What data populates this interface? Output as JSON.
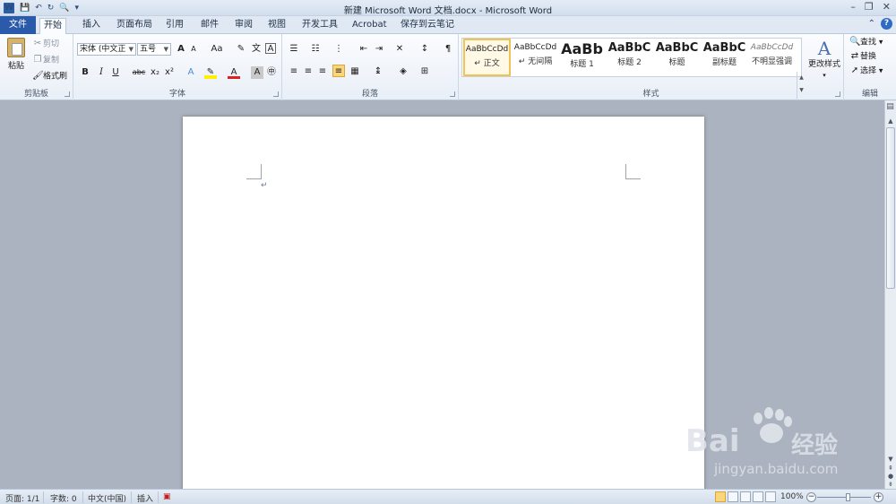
{
  "window": {
    "title": "新建 Microsoft Word 文档.docx - Microsoft Word",
    "qat_icons": [
      "word-icon",
      "save-icon",
      "undo-icon",
      "redo-icon",
      "print-preview-icon",
      "customize-qat-icon"
    ],
    "controls": {
      "minimize": "–",
      "restore": "❐",
      "close": "✕"
    }
  },
  "tabs": {
    "file": "文件",
    "items": [
      "开始",
      "插入",
      "页面布局",
      "引用",
      "邮件",
      "审阅",
      "视图",
      "开发工具",
      "Acrobat",
      "保存到云笔记"
    ],
    "active": "开始"
  },
  "clipboard": {
    "paste": "粘贴",
    "cut": "剪切",
    "copy": "复制",
    "format_painter": "格式刷",
    "label": "剪贴板"
  },
  "font": {
    "font_name": "宋体 (中文正",
    "font_size": "五号",
    "grow": "A",
    "shrink": "A",
    "change_case": "Aa",
    "bold": "B",
    "italic": "I",
    "underline": "U",
    "strike": "abc",
    "subscript": "x₂",
    "superscript": "x²",
    "label": "字体"
  },
  "paragraph": {
    "label": "段落"
  },
  "styles": {
    "items": [
      {
        "sample": "AaBbCcDd",
        "name": "↵ 正文"
      },
      {
        "sample": "AaBbCcDd",
        "name": "↵ 无间隔"
      },
      {
        "sample": "AaBb",
        "name": "标题 1"
      },
      {
        "sample": "AaBbC",
        "name": "标题 2"
      },
      {
        "sample": "AaBbC",
        "name": "标题"
      },
      {
        "sample": "AaBbC",
        "name": "副标题"
      },
      {
        "sample": "AaBbCcDd",
        "name": "不明显强调"
      }
    ],
    "change": "更改样式",
    "label": "样式"
  },
  "editing": {
    "find": "查找",
    "replace": "替换",
    "select": "选择",
    "label": "编辑"
  },
  "document": {
    "paragraph_mark": "↵"
  },
  "status": {
    "page": "页面: 1/1",
    "words": "字数: 0",
    "language": "中文(中国)",
    "mode": "插入",
    "zoom": "100%"
  },
  "watermark": {
    "brand": "Bai",
    "suffix": "经验",
    "url": "jingyan.baidu.com"
  }
}
